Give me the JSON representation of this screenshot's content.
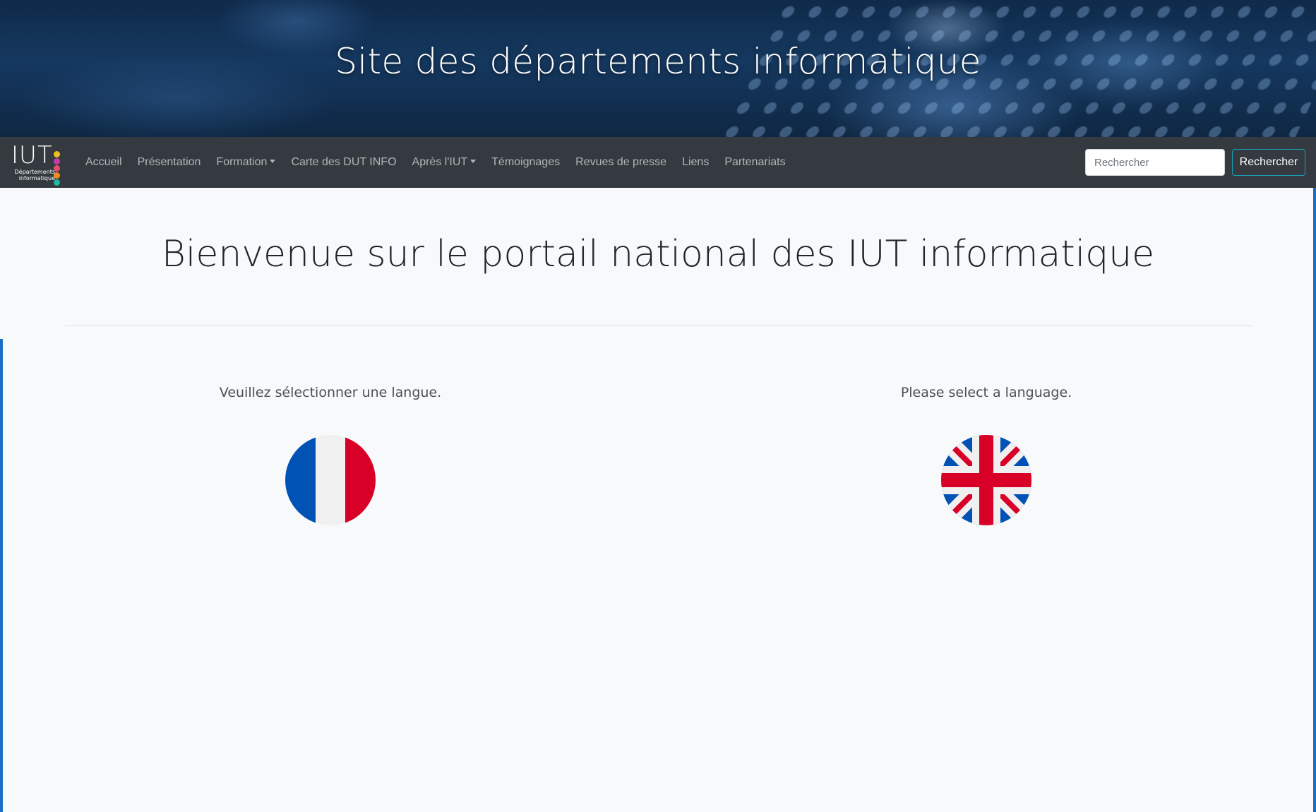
{
  "banner": {
    "title": "Site des départements informatique"
  },
  "logo": {
    "text": "IUT",
    "subtitle_line1": "Départements",
    "subtitle_line2": "informatique",
    "dot_colors": [
      "#f2c01d",
      "#c43ca3",
      "#e24f6d",
      "#f28b1d",
      "#1db9a0"
    ]
  },
  "nav": {
    "items": [
      {
        "label": "Accueil",
        "dropdown": false
      },
      {
        "label": "Présentation",
        "dropdown": false
      },
      {
        "label": "Formation",
        "dropdown": true
      },
      {
        "label": "Carte des DUT INFO",
        "dropdown": false
      },
      {
        "label": "Après l'IUT",
        "dropdown": true
      },
      {
        "label": "Témoignages",
        "dropdown": false
      },
      {
        "label": "Revues de presse",
        "dropdown": false
      },
      {
        "label": "Liens",
        "dropdown": false
      },
      {
        "label": "Partenariats",
        "dropdown": false
      }
    ]
  },
  "search": {
    "placeholder": "Rechercher",
    "button_label": "Rechercher"
  },
  "main": {
    "heading": "Bienvenue sur le portail national des IUT informatique",
    "french": {
      "prompt": "Veuillez sélectionner une langue.",
      "flag_icon": "france-flag-icon"
    },
    "english": {
      "prompt": "Please select a language.",
      "flag_icon": "uk-flag-icon"
    }
  },
  "colors": {
    "navbar": "#343a40",
    "page_bg": "#f8f9fa",
    "side_accent": "#1a6fc4",
    "button_border": "#17a2b8"
  }
}
